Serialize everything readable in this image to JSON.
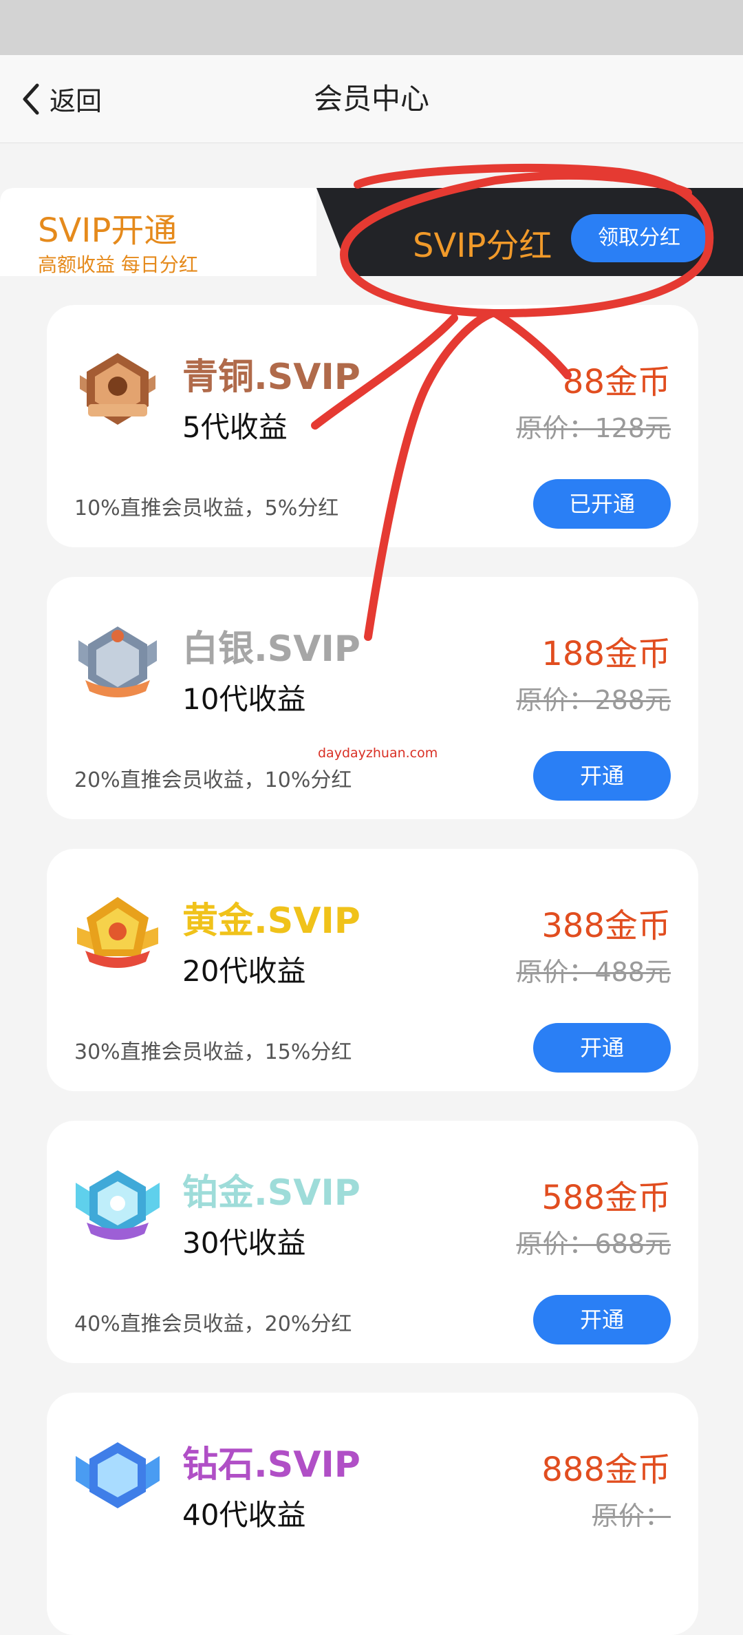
{
  "nav": {
    "back_label": "返回",
    "title": "会员中心"
  },
  "tabs": {
    "open_title": "SVIP开通",
    "open_subtitle": "高额收益 每日分红",
    "dividend_title": "SVIP分红",
    "claim_button": "领取分红"
  },
  "watermark": "daydayzhuan.com",
  "cards": [
    {
      "name": "青铜.SVIP",
      "name_color": "#b06a4a",
      "generations": "5代收益",
      "price": "88金币",
      "original_price": "原价：128元",
      "description": "10%直推会员收益，5%分红",
      "button": "已开通",
      "badge_icon": "bronze-badge-icon"
    },
    {
      "name": "白银.SVIP",
      "name_color": "#a6a6a6",
      "generations": "10代收益",
      "price": "188金币",
      "original_price": "原价：288元",
      "description": "20%直推会员收益，10%分红",
      "button": "开通",
      "badge_icon": "silver-badge-icon"
    },
    {
      "name": "黄金.SVIP",
      "name_color": "#f0c21a",
      "generations": "20代收益",
      "price": "388金币",
      "original_price": "原价：488元",
      "description": "30%直推会员收益，15%分红",
      "button": "开通",
      "badge_icon": "gold-badge-icon"
    },
    {
      "name": "铂金.SVIP",
      "name_color": "#9edcd9",
      "generations": "30代收益",
      "price": "588金币",
      "original_price": "原价：688元",
      "description": "40%直推会员收益，20%分红",
      "button": "开通",
      "badge_icon": "platinum-badge-icon"
    },
    {
      "name": "钻石.SVIP",
      "name_color": "#b04fc6",
      "generations": "40代收益",
      "price": "888金币",
      "original_price": "原价：",
      "description": "",
      "button": "",
      "badge_icon": "diamond-badge-icon"
    }
  ]
}
